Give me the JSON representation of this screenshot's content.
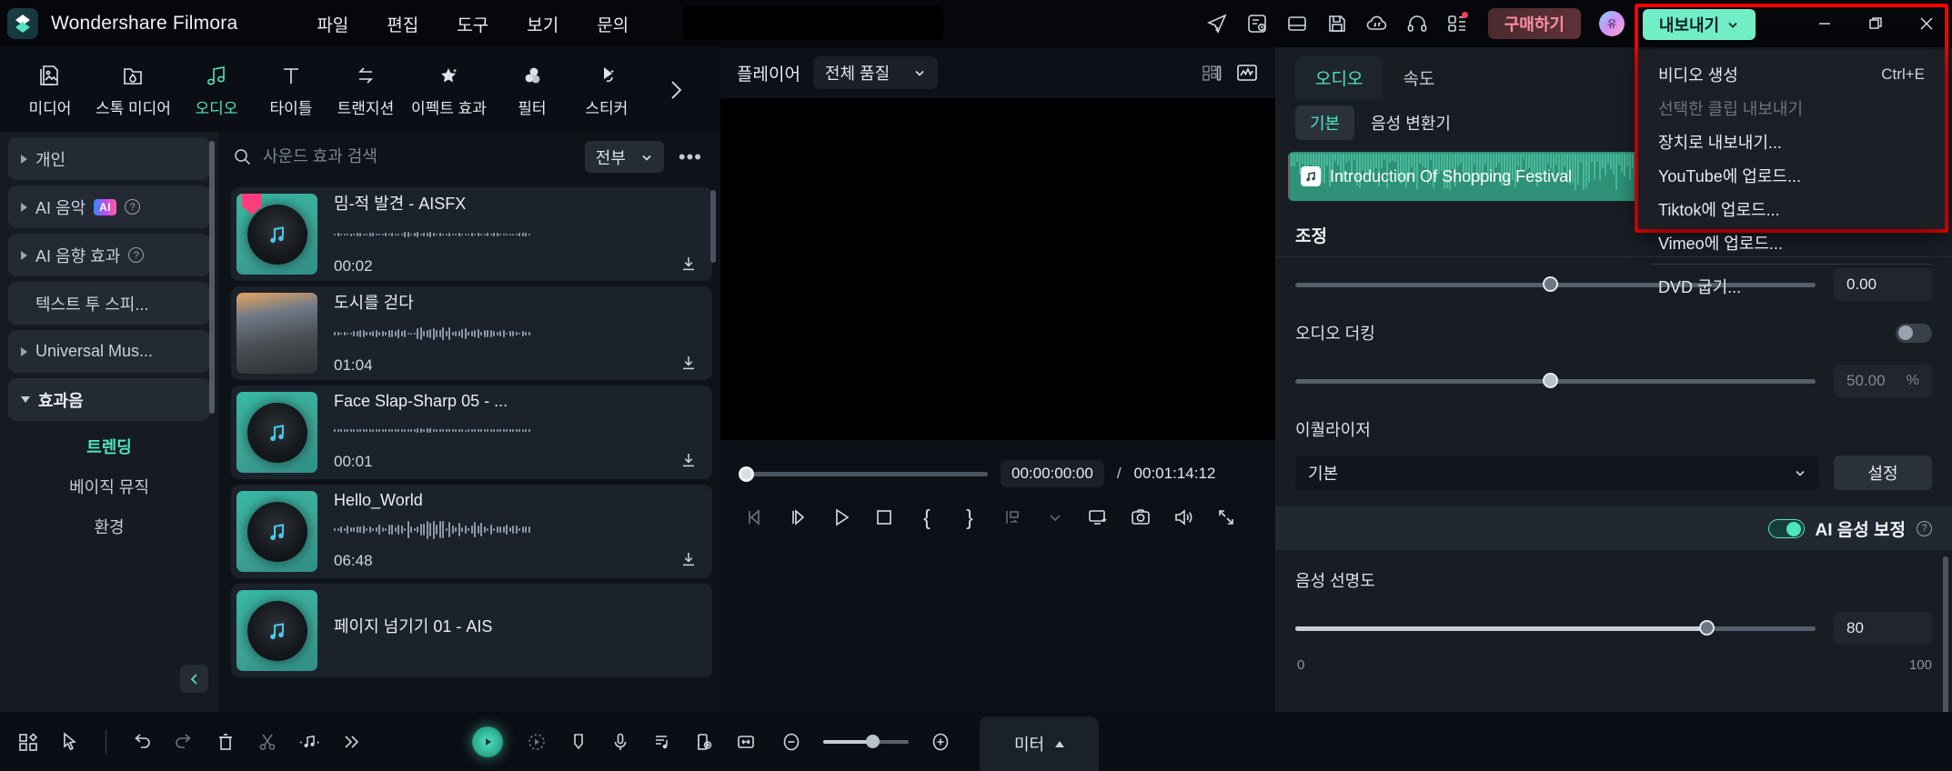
{
  "app": {
    "brand": "Wondershare Filmora",
    "accent": "#4fe3c1",
    "export_accent": "#72eec6",
    "highlight_color": "#ff0000"
  },
  "menubar": {
    "items": [
      {
        "label": "파일"
      },
      {
        "label": "편집"
      },
      {
        "label": "도구"
      },
      {
        "label": "보기"
      },
      {
        "label": "문의"
      }
    ]
  },
  "titlebar": {
    "project_field_value": "",
    "buy_label": "구매하기",
    "avatar_label": "유",
    "icons": [
      {
        "name": "send-icon"
      },
      {
        "name": "task-history-icon"
      },
      {
        "name": "layout-icon"
      },
      {
        "name": "save-icon"
      },
      {
        "name": "cloud-transfer-icon"
      },
      {
        "name": "headset-support-icon"
      },
      {
        "name": "apps-grid-icon"
      }
    ],
    "window": {
      "minimize": "—",
      "maximize": "❐",
      "close": "✕"
    }
  },
  "export": {
    "button_label": "내보내기",
    "menu": [
      {
        "label": "비디오 생성",
        "shortcut": "Ctrl+E",
        "disabled": false
      },
      {
        "label": "선택한 클립 내보내기",
        "shortcut": "",
        "disabled": true
      },
      {
        "label": "장치로 내보내기...",
        "shortcut": "",
        "disabled": false
      },
      {
        "label": "YouTube에 업로드...",
        "shortcut": "",
        "disabled": false
      },
      {
        "label": "Tiktok에 업로드...",
        "shortcut": "",
        "disabled": false
      },
      {
        "label": "Vimeo에 업로드...",
        "shortcut": "",
        "disabled": false
      },
      {
        "label": "DVD 굽기...",
        "shortcut": "",
        "disabled": false,
        "after_separator": true
      }
    ]
  },
  "tabstrip": {
    "tabs": [
      {
        "label": "미디어",
        "icon": "media-icon",
        "active": false
      },
      {
        "label": "스톡 미디어",
        "icon": "stock-media-icon",
        "active": false
      },
      {
        "label": "오디오",
        "icon": "audio-note-icon",
        "active": true
      },
      {
        "label": "타이틀",
        "icon": "title-text-icon",
        "active": false
      },
      {
        "label": "트랜지션",
        "icon": "transition-arrow-icon",
        "active": false
      },
      {
        "label": "이펙트 효과",
        "icon": "effect-star-icon",
        "active": false
      },
      {
        "label": "필터",
        "icon": "filter-circles-icon",
        "active": false
      },
      {
        "label": "스티커",
        "icon": "sticker-icon",
        "active": false
      }
    ],
    "more_icon": "chevron-right-icon"
  },
  "sidebar": {
    "items": [
      {
        "label": "개인",
        "expandable": true,
        "expanded": false,
        "badge": null,
        "help": false
      },
      {
        "label": "AI 음악",
        "expandable": true,
        "expanded": false,
        "badge": "AI",
        "help": true
      },
      {
        "label": "AI 음향 효과",
        "expandable": true,
        "expanded": false,
        "badge": null,
        "help": true
      },
      {
        "label": "텍스트 투 스피...",
        "expandable": false,
        "expanded": false,
        "badge": null,
        "help": false
      },
      {
        "label": "Universal Mus...",
        "expandable": true,
        "expanded": false,
        "badge": null,
        "help": false
      },
      {
        "label": "효과음",
        "expandable": true,
        "expanded": true,
        "badge": null,
        "help": false
      }
    ],
    "subitems": [
      {
        "label": "트렌딩",
        "active": true
      },
      {
        "label": "베이직 뮤직",
        "active": false
      },
      {
        "label": "환경",
        "active": false
      }
    ],
    "collapse_icon": "chevron-left-icon"
  },
  "media": {
    "search_placeholder": "사운드 효과 검색",
    "search_value": "",
    "filter_label": "전부",
    "more_label": "•••",
    "items": [
      {
        "title": "밈-적 발견 - AISFX",
        "duration": "00:02",
        "thumb": "disc",
        "favorite": true
      },
      {
        "title": "도시를 걷다",
        "duration": "01:04",
        "thumb": "photo",
        "favorite": false
      },
      {
        "title": "Face Slap-Sharp 05 - ...",
        "duration": "00:01",
        "thumb": "disc",
        "favorite": false
      },
      {
        "title": "Hello_World",
        "duration": "06:48",
        "thumb": "disc",
        "favorite": false
      },
      {
        "title": "페이지 넘기기 01 - AIS",
        "duration": "",
        "thumb": "disc",
        "favorite": false
      }
    ]
  },
  "player": {
    "title": "플레이어",
    "quality_label": "전체 품질",
    "grid_icon": "grid-view-icon",
    "scope_icon": "waveform-scope-icon",
    "current_time": "00:00:00:00",
    "separator": "/",
    "total_time": "00:01:14:12",
    "controls": [
      {
        "name": "prev-frame-button",
        "label": "◁|"
      },
      {
        "name": "next-frame-button",
        "label": "|▷"
      },
      {
        "name": "play-button",
        "label": "▷"
      },
      {
        "name": "stop-button",
        "label": "□"
      },
      {
        "name": "mark-in-button",
        "label": "{"
      },
      {
        "name": "mark-out-button",
        "label": "}"
      },
      {
        "name": "markers-button",
        "label": "marker"
      },
      {
        "name": "markers-dropdown",
        "label": "chevron"
      },
      {
        "name": "display-mode-button",
        "label": "display"
      },
      {
        "name": "snapshot-button",
        "label": "camera"
      },
      {
        "name": "volume-button",
        "label": "speaker"
      },
      {
        "name": "fullscreen-button",
        "label": "expand"
      }
    ]
  },
  "rightpanel": {
    "tabs": [
      {
        "label": "오디오",
        "active": true
      },
      {
        "label": "속도",
        "active": false
      }
    ],
    "chip_label": "기본",
    "sub_item_label": "음성 변환기",
    "clip": {
      "name": "Introduction Of Shopping Festival"
    },
    "section_title": "조정",
    "volume_value": "0.00",
    "volume_slider_pct": 49,
    "ducking_label": "오디오 더킹",
    "ducking_on": false,
    "ducking_value": "50.00",
    "ducking_unit": "%",
    "ducking_slider_pct": 49,
    "equalizer_label": "이퀄라이저",
    "equalizer_value": "기본",
    "equalizer_button": "설정",
    "ai_voice_label": "AI 음성 보정",
    "ai_voice_on": true,
    "clarity_label": "음성 선명도",
    "clarity_value": "80",
    "clarity_slider_pct": 79,
    "clarity_min": "0",
    "clarity_max": "100"
  },
  "bottombar": {
    "left_icons": [
      {
        "name": "grid-add-icon",
        "dim": false
      },
      {
        "name": "select-tool-icon",
        "dim": false
      }
    ],
    "edit_icons": [
      {
        "name": "undo-icon",
        "dim": false
      },
      {
        "name": "redo-icon",
        "dim": true
      },
      {
        "name": "delete-icon",
        "dim": false
      },
      {
        "name": "split-scissors-icon",
        "dim": true
      },
      {
        "name": "audio-trim-icon",
        "dim": false
      },
      {
        "name": "more-chevrons-icon",
        "dim": false
      }
    ],
    "center_icons": [
      {
        "name": "record-voiceover-icon",
        "dim": false
      },
      {
        "name": "motion-tracking-icon",
        "dim": true
      },
      {
        "name": "marker-icon",
        "dim": false
      },
      {
        "name": "microphone-icon",
        "dim": false
      },
      {
        "name": "audio-mixer-icon",
        "dim": false
      },
      {
        "name": "keyframe-icon",
        "dim": false
      },
      {
        "name": "fit-timeline-icon",
        "dim": false
      }
    ],
    "zoom_out_icon": "zoom-out-icon",
    "zoom_in_icon": "zoom-in-icon",
    "zoom_pct": 57,
    "meter_label": "미터"
  }
}
